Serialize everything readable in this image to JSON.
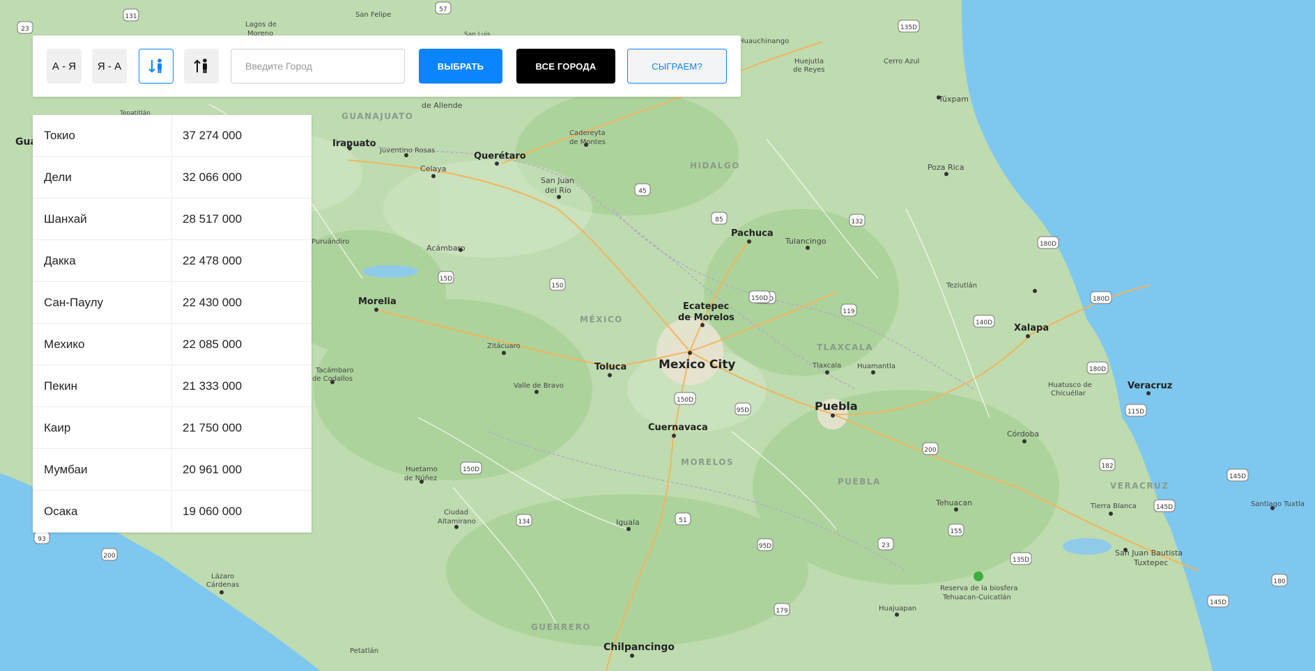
{
  "toolbar": {
    "sort_az": "А - Я",
    "sort_za": "Я - А",
    "input_placeholder": "Введите Город",
    "choose_label": "ВЫБРАТЬ",
    "all_cities_label": "ВСЕ ГОРОДА",
    "play_label": "СЫГРАЕМ?"
  },
  "cities": [
    {
      "name": "Токио",
      "population": "37 274 000"
    },
    {
      "name": "Дели",
      "population": "32 066 000"
    },
    {
      "name": "Шанхай",
      "population": "28 517 000"
    },
    {
      "name": "Дакка",
      "population": "22 478 000"
    },
    {
      "name": "Сан-Паулу",
      "population": "22 430 000"
    },
    {
      "name": "Мехико",
      "population": "22 085 000"
    },
    {
      "name": "Пекин",
      "population": "21 333 000"
    },
    {
      "name": "Каир",
      "population": "21 750 000"
    },
    {
      "name": "Мумбаи",
      "population": "20 961 000"
    },
    {
      "name": "Осака",
      "population": "19 060 000"
    }
  ],
  "map": {
    "cities": {
      "mexico_city": "Mexico City",
      "puebla": "Puebla",
      "toluca": "Toluca",
      "cuernavaca": "Cuernavaca",
      "pachuca": "Pachuca",
      "ecatepec1": "Ecatepec",
      "ecatepec2": "de Morelos",
      "queretaro": "Querétaro",
      "irapuato": "Irapuato",
      "morelia": "Morelia",
      "xalapa": "Xalapa",
      "veracruz": "Veracruz",
      "chilpancingo": "Chilpancingo",
      "celaya": "Celaya",
      "tulancingo": "Tulancingo",
      "poza_rica": "Poza Rica",
      "tuxpam": "Túxpam",
      "cordoba": "Córdoba",
      "tehuacan": "Tehuacan",
      "iguala": "Iguala",
      "tlaxcala": "Tlaxcala",
      "huamantla": "Huamantla",
      "zitacuaro": "Zitácuaro",
      "valle_de_bravo": "Valle de Bravo",
      "acambaro": "Acámbaro",
      "san_juan_del_rio1": "San Juan",
      "san_juan_del_rio2": "del Río",
      "cadereyta1": "Cadereyta",
      "cadereyta2": "de Montes",
      "teziutlan": "Teziutlán",
      "huajuapan": "Huajuapan",
      "tierra_blanca": "Tierra Blanca",
      "santiago_tuxtla": "Santiago Tuxtla",
      "sjb1": "San Juan Bautista",
      "sjb2": "Tuxtepec",
      "lazaro1": "Lázaro",
      "lazaro2": "Cárdenas",
      "petatlan": "Petatlán",
      "altamirano1": "Ciudad",
      "altamirano2": "Altamirano",
      "huetamo1": "Huetamo",
      "huetamo2": "de Núñez",
      "tacambaro1": "Tacámbaro",
      "tacambaro2": "de Codallos",
      "puruandiro": "Puruándiro",
      "juventino": "Juventino Rosas",
      "allende": "de Allende",
      "lagos1": "Lagos de",
      "lagos2": "Moreno",
      "san_felipe": "San Felipe",
      "huejutla1": "Huejutla",
      "huejutla2": "de Reyes",
      "cerro_azul": "Cerro Azul",
      "huauchinango1": "Huauchinango",
      "chicuellar1": "Huatusco de",
      "chicuellar2": "Chicuéllar",
      "reserva1": "Reserva de la biosfera",
      "reserva2": "Tehuacan-Cuicatlán",
      "gua": "Gua",
      "tepatitlan": "Tepatitlán",
      "sanluis": "San Luis"
    },
    "regions": {
      "guanajuato": "GUANAJUATO",
      "hidalgo": "HIDALGO",
      "mexico": "MÉXICO",
      "tlaxcala": "TLAXCALA",
      "morelos": "MORELOS",
      "puebla": "PUEBLA",
      "veracruz": "VERACRUZ",
      "guerrero": "GUERRERO"
    },
    "shields": [
      "131",
      "57",
      "23",
      "135D",
      "45",
      "85",
      "132",
      "180D",
      "150",
      "15D",
      "140D",
      "119",
      "140D",
      "180D",
      "180D",
      "150D",
      "95D",
      "115D",
      "150D",
      "134",
      "51",
      "95D",
      "23",
      "155",
      "135D",
      "182",
      "145D",
      "145D",
      "180",
      "145D",
      "179",
      "93",
      "200",
      "200",
      "150D"
    ]
  }
}
